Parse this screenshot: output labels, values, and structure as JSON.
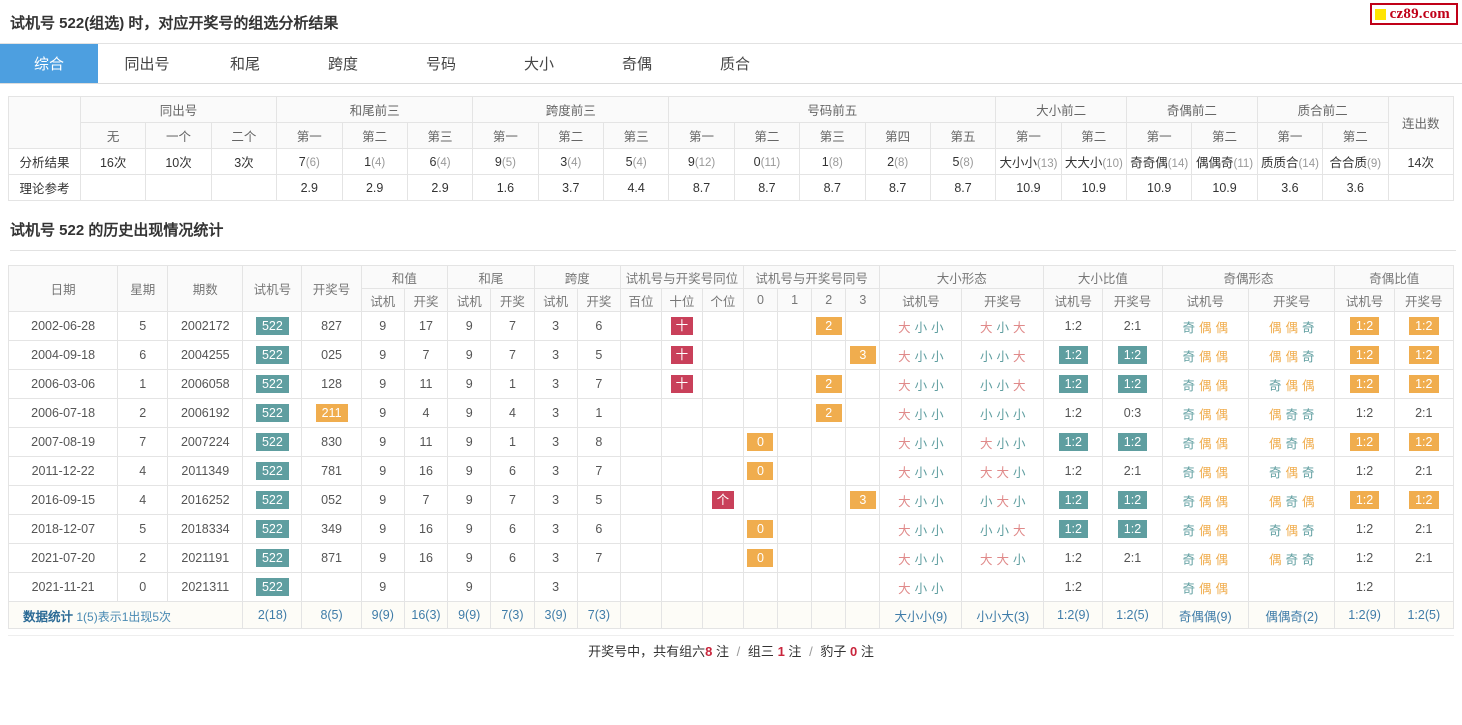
{
  "logo": {
    "text": "cz89.com",
    "square_color": "#ffe400",
    "border_color": "#c00018"
  },
  "header": {
    "title": "试机号 522(组选) 时，对应开奖号的组选分析结果"
  },
  "tabs": [
    {
      "label": "综合",
      "active": true
    },
    {
      "label": "同出号",
      "active": false
    },
    {
      "label": "和尾",
      "active": false
    },
    {
      "label": "跨度",
      "active": false
    },
    {
      "label": "号码",
      "active": false
    },
    {
      "label": "大小",
      "active": false
    },
    {
      "label": "奇偶",
      "active": false
    },
    {
      "label": "质合",
      "active": false
    }
  ],
  "summary": {
    "groups": [
      {
        "label": "",
        "span": 1
      },
      {
        "label": "同出号",
        "span": 3
      },
      {
        "label": "和尾前三",
        "span": 3
      },
      {
        "label": "跨度前三",
        "span": 3
      },
      {
        "label": "号码前五",
        "span": 5
      },
      {
        "label": "大小前二",
        "span": 2
      },
      {
        "label": "奇偶前二",
        "span": 2
      },
      {
        "label": "质合前二",
        "span": 2
      },
      {
        "label": "连出数",
        "span": 1,
        "rowspan": 2
      }
    ],
    "subheaders": [
      "",
      "无",
      "一个",
      "二个",
      "第一",
      "第二",
      "第三",
      "第一",
      "第二",
      "第三",
      "第一",
      "第二",
      "第三",
      "第四",
      "第五",
      "第一",
      "第二",
      "第一",
      "第二",
      "第一",
      "第二"
    ],
    "rows": [
      {
        "label": "分析结果",
        "cells": [
          {
            "main": "16次",
            "sub": ""
          },
          {
            "main": "10次",
            "sub": ""
          },
          {
            "main": "3次",
            "sub": ""
          },
          {
            "main": "7",
            "sub": "(6)"
          },
          {
            "main": "1",
            "sub": "(4)"
          },
          {
            "main": "6",
            "sub": "(4)"
          },
          {
            "main": "9",
            "sub": "(5)"
          },
          {
            "main": "3",
            "sub": "(4)"
          },
          {
            "main": "5",
            "sub": "(4)"
          },
          {
            "main": "9",
            "sub": "(12)"
          },
          {
            "main": "0",
            "sub": "(11)"
          },
          {
            "main": "1",
            "sub": "(8)"
          },
          {
            "main": "2",
            "sub": "(8)"
          },
          {
            "main": "5",
            "sub": "(8)"
          },
          {
            "main": "大小小",
            "sub": "(13)"
          },
          {
            "main": "大大小",
            "sub": "(10)"
          },
          {
            "main": "奇奇偶",
            "sub": "(14)"
          },
          {
            "main": "偶偶奇",
            "sub": "(11)"
          },
          {
            "main": "质质合",
            "sub": "(14)"
          },
          {
            "main": "合合质",
            "sub": "(9)"
          },
          {
            "main": "14次",
            "sub": ""
          }
        ]
      },
      {
        "label": "理论参考",
        "cells": [
          {
            "main": "",
            "sub": ""
          },
          {
            "main": "",
            "sub": ""
          },
          {
            "main": "",
            "sub": ""
          },
          {
            "main": "2.9",
            "sub": ""
          },
          {
            "main": "2.9",
            "sub": ""
          },
          {
            "main": "2.9",
            "sub": ""
          },
          {
            "main": "1.6",
            "sub": ""
          },
          {
            "main": "3.7",
            "sub": ""
          },
          {
            "main": "4.4",
            "sub": ""
          },
          {
            "main": "8.7",
            "sub": ""
          },
          {
            "main": "8.7",
            "sub": ""
          },
          {
            "main": "8.7",
            "sub": ""
          },
          {
            "main": "8.7",
            "sub": ""
          },
          {
            "main": "8.7",
            "sub": ""
          },
          {
            "main": "10.9",
            "sub": ""
          },
          {
            "main": "10.9",
            "sub": ""
          },
          {
            "main": "10.9",
            "sub": ""
          },
          {
            "main": "10.9",
            "sub": ""
          },
          {
            "main": "3.6",
            "sub": ""
          },
          {
            "main": "3.6",
            "sub": ""
          },
          {
            "main": "",
            "sub": ""
          }
        ]
      }
    ]
  },
  "section": {
    "title": "试机号 522 的历史出现情况统计"
  },
  "history": {
    "group_headers": [
      {
        "label": "日期",
        "span": 1,
        "rowspan": 2
      },
      {
        "label": "星期",
        "span": 1,
        "rowspan": 2
      },
      {
        "label": "期数",
        "span": 1,
        "rowspan": 2
      },
      {
        "label": "试机号",
        "span": 1,
        "rowspan": 2
      },
      {
        "label": "开奖号",
        "span": 1,
        "rowspan": 2
      },
      {
        "label": "和值",
        "span": 2
      },
      {
        "label": "和尾",
        "span": 2
      },
      {
        "label": "跨度",
        "span": 2
      },
      {
        "label": "试机号与开奖号同位",
        "span": 3
      },
      {
        "label": "试机号与开奖号同号",
        "span": 4
      },
      {
        "label": "大小形态",
        "span": 2
      },
      {
        "label": "大小比值",
        "span": 2
      },
      {
        "label": "奇偶形态",
        "span": 2
      },
      {
        "label": "奇偶比值",
        "span": 2
      }
    ],
    "sub_headers": [
      "试机",
      "开奖",
      "试机",
      "开奖",
      "试机",
      "开奖",
      "百位",
      "十位",
      "个位",
      "0",
      "1",
      "2",
      "3",
      "试机号",
      "开奖号",
      "试机号",
      "开奖号",
      "试机号",
      "开奖号",
      "试机号",
      "开奖号"
    ],
    "rows": [
      {
        "date": "2002-06-28",
        "week": "5",
        "issue": "2002172",
        "test": "522",
        "draw": "827",
        "draw_badge": false,
        "he_test": "9",
        "he_draw": "17",
        "wei_test": "9",
        "wei_draw": "7",
        "kua_test": "3",
        "kua_draw": "6",
        "pos": [
          "",
          "十",
          ""
        ],
        "pos_badge": [
          false,
          true,
          false
        ],
        "same": [
          "",
          "",
          "2",
          ""
        ],
        "same_badge": [
          false,
          false,
          true,
          false
        ],
        "size_test": "大小小",
        "size_draw": "大小大",
        "size_ratio_test": "1:2",
        "size_ratio_test_badge": false,
        "size_ratio_draw": "2:1",
        "size_ratio_draw_badge": false,
        "size_ratio_draw_color": "rose",
        "par_test": "奇偶偶",
        "par_draw": "偶偶奇",
        "par_ratio_test": "1:2",
        "par_ratio_test_badge": true,
        "par_ratio_draw": "1:2",
        "par_ratio_draw_badge": true
      },
      {
        "date": "2004-09-18",
        "week": "6",
        "issue": "2004255",
        "test": "522",
        "draw": "025",
        "draw_badge": false,
        "he_test": "9",
        "he_draw": "7",
        "wei_test": "9",
        "wei_draw": "7",
        "kua_test": "3",
        "kua_draw": "5",
        "pos": [
          "",
          "十",
          ""
        ],
        "pos_badge": [
          false,
          true,
          false
        ],
        "same": [
          "",
          "",
          "",
          "3"
        ],
        "same_badge": [
          false,
          false,
          false,
          true
        ],
        "size_test": "大小小",
        "size_draw": "小小大",
        "size_ratio_test": "1:2",
        "size_ratio_test_badge": true,
        "size_ratio_draw": "1:2",
        "size_ratio_draw_badge": true,
        "size_ratio_draw_color": "",
        "par_test": "奇偶偶",
        "par_draw": "偶偶奇",
        "par_ratio_test": "1:2",
        "par_ratio_test_badge": true,
        "par_ratio_draw": "1:2",
        "par_ratio_draw_badge": true
      },
      {
        "date": "2006-03-06",
        "week": "1",
        "issue": "2006058",
        "test": "522",
        "draw": "128",
        "draw_badge": false,
        "he_test": "9",
        "he_draw": "11",
        "wei_test": "9",
        "wei_draw": "1",
        "kua_test": "3",
        "kua_draw": "7",
        "pos": [
          "",
          "十",
          ""
        ],
        "pos_badge": [
          false,
          true,
          false
        ],
        "same": [
          "",
          "",
          "2",
          ""
        ],
        "same_badge": [
          false,
          false,
          true,
          false
        ],
        "size_test": "大小小",
        "size_draw": "小小大",
        "size_ratio_test": "1:2",
        "size_ratio_test_badge": true,
        "size_ratio_draw": "1:2",
        "size_ratio_draw_badge": true,
        "size_ratio_draw_color": "",
        "par_test": "奇偶偶",
        "par_draw": "奇偶偶",
        "par_ratio_test": "1:2",
        "par_ratio_test_badge": true,
        "par_ratio_draw": "1:2",
        "par_ratio_draw_badge": true
      },
      {
        "date": "2006-07-18",
        "week": "2",
        "issue": "2006192",
        "test": "522",
        "draw": "211",
        "draw_badge": true,
        "he_test": "9",
        "he_draw": "4",
        "wei_test": "9",
        "wei_draw": "4",
        "kua_test": "3",
        "kua_draw": "1",
        "pos": [
          "",
          "",
          ""
        ],
        "pos_badge": [
          false,
          false,
          false
        ],
        "same": [
          "",
          "",
          "2",
          ""
        ],
        "same_badge": [
          false,
          false,
          true,
          false
        ],
        "size_test": "大小小",
        "size_draw": "小小小",
        "size_ratio_test": "1:2",
        "size_ratio_test_badge": false,
        "size_ratio_draw": "0:3",
        "size_ratio_draw_badge": false,
        "size_ratio_draw_color": "rose",
        "par_test": "奇偶偶",
        "par_draw": "偶奇奇",
        "par_ratio_test": "1:2",
        "par_ratio_test_badge": false,
        "par_ratio_draw": "2:1",
        "par_ratio_draw_badge": false
      },
      {
        "date": "2007-08-19",
        "week": "7",
        "issue": "2007224",
        "test": "522",
        "draw": "830",
        "draw_badge": false,
        "he_test": "9",
        "he_draw": "11",
        "wei_test": "9",
        "wei_draw": "1",
        "kua_test": "3",
        "kua_draw": "8",
        "pos": [
          "",
          "",
          ""
        ],
        "pos_badge": [
          false,
          false,
          false
        ],
        "same": [
          "0",
          "",
          "",
          ""
        ],
        "same_badge": [
          true,
          false,
          false,
          false
        ],
        "size_test": "大小小",
        "size_draw": "大小小",
        "size_ratio_test": "1:2",
        "size_ratio_test_badge": true,
        "size_ratio_draw": "1:2",
        "size_ratio_draw_badge": true,
        "size_ratio_draw_color": "",
        "par_test": "奇偶偶",
        "par_draw": "偶奇偶",
        "par_ratio_test": "1:2",
        "par_ratio_test_badge": true,
        "par_ratio_draw": "1:2",
        "par_ratio_draw_badge": true
      },
      {
        "date": "2011-12-22",
        "week": "4",
        "issue": "2011349",
        "test": "522",
        "draw": "781",
        "draw_badge": false,
        "he_test": "9",
        "he_draw": "16",
        "wei_test": "9",
        "wei_draw": "6",
        "kua_test": "3",
        "kua_draw": "7",
        "pos": [
          "",
          "",
          ""
        ],
        "pos_badge": [
          false,
          false,
          false
        ],
        "same": [
          "0",
          "",
          "",
          ""
        ],
        "same_badge": [
          true,
          false,
          false,
          false
        ],
        "size_test": "大小小",
        "size_draw": "大大小",
        "size_ratio_test": "1:2",
        "size_ratio_test_badge": false,
        "size_ratio_draw": "2:1",
        "size_ratio_draw_badge": false,
        "size_ratio_draw_color": "rose",
        "par_test": "奇偶偶",
        "par_draw": "奇偶奇",
        "par_ratio_test": "1:2",
        "par_ratio_test_badge": false,
        "par_ratio_draw": "2:1",
        "par_ratio_draw_badge": false
      },
      {
        "date": "2016-09-15",
        "week": "4",
        "issue": "2016252",
        "test": "522",
        "draw": "052",
        "draw_badge": false,
        "he_test": "9",
        "he_draw": "7",
        "wei_test": "9",
        "wei_draw": "7",
        "kua_test": "3",
        "kua_draw": "5",
        "pos": [
          "",
          "",
          "个"
        ],
        "pos_badge": [
          false,
          false,
          true
        ],
        "same": [
          "",
          "",
          "",
          "3"
        ],
        "same_badge": [
          false,
          false,
          false,
          true
        ],
        "size_test": "大小小",
        "size_draw": "小大小",
        "size_ratio_test": "1:2",
        "size_ratio_test_badge": true,
        "size_ratio_draw": "1:2",
        "size_ratio_draw_badge": true,
        "size_ratio_draw_color": "",
        "par_test": "奇偶偶",
        "par_draw": "偶奇偶",
        "par_ratio_test": "1:2",
        "par_ratio_test_badge": true,
        "par_ratio_draw": "1:2",
        "par_ratio_draw_badge": true
      },
      {
        "date": "2018-12-07",
        "week": "5",
        "issue": "2018334",
        "test": "522",
        "draw": "349",
        "draw_badge": false,
        "he_test": "9",
        "he_draw": "16",
        "wei_test": "9",
        "wei_draw": "6",
        "kua_test": "3",
        "kua_draw": "6",
        "pos": [
          "",
          "",
          ""
        ],
        "pos_badge": [
          false,
          false,
          false
        ],
        "same": [
          "0",
          "",
          "",
          ""
        ],
        "same_badge": [
          true,
          false,
          false,
          false
        ],
        "size_test": "大小小",
        "size_draw": "小小大",
        "size_ratio_test": "1:2",
        "size_ratio_test_badge": true,
        "size_ratio_draw": "1:2",
        "size_ratio_draw_badge": true,
        "size_ratio_draw_color": "",
        "par_test": "奇偶偶",
        "par_draw": "奇偶奇",
        "par_ratio_test": "1:2",
        "par_ratio_test_badge": false,
        "par_ratio_draw": "2:1",
        "par_ratio_draw_badge": false
      },
      {
        "date": "2021-07-20",
        "week": "2",
        "issue": "2021191",
        "test": "522",
        "draw": "871",
        "draw_badge": false,
        "he_test": "9",
        "he_draw": "16",
        "wei_test": "9",
        "wei_draw": "6",
        "kua_test": "3",
        "kua_draw": "7",
        "pos": [
          "",
          "",
          ""
        ],
        "pos_badge": [
          false,
          false,
          false
        ],
        "same": [
          "0",
          "",
          "",
          ""
        ],
        "same_badge": [
          true,
          false,
          false,
          false
        ],
        "size_test": "大小小",
        "size_draw": "大大小",
        "size_ratio_test": "1:2",
        "size_ratio_test_badge": false,
        "size_ratio_draw": "2:1",
        "size_ratio_draw_badge": false,
        "size_ratio_draw_color": "rose",
        "par_test": "奇偶偶",
        "par_draw": "偶奇奇",
        "par_ratio_test": "1:2",
        "par_ratio_test_badge": false,
        "par_ratio_draw": "2:1",
        "par_ratio_draw_badge": false
      },
      {
        "date": "2021-11-21",
        "week": "0",
        "issue": "2021311",
        "test": "522",
        "draw": "",
        "draw_badge": false,
        "he_test": "9",
        "he_draw": "",
        "wei_test": "9",
        "wei_draw": "",
        "kua_test": "3",
        "kua_draw": "",
        "pos": [
          "",
          "",
          ""
        ],
        "pos_badge": [
          false,
          false,
          false
        ],
        "same": [
          "",
          "",
          "",
          ""
        ],
        "same_badge": [
          false,
          false,
          false,
          false
        ],
        "size_test": "大小小",
        "size_draw": "",
        "size_ratio_test": "1:2",
        "size_ratio_test_badge": false,
        "size_ratio_draw": "",
        "size_ratio_draw_badge": false,
        "size_ratio_draw_color": "",
        "par_test": "奇偶偶",
        "par_draw": "",
        "par_ratio_test": "1:2",
        "par_ratio_test_badge": false,
        "par_ratio_draw": "",
        "par_ratio_draw_badge": false
      }
    ],
    "stats": {
      "label": "数据统计",
      "note": "1(5)表示1出现5次",
      "test_num": "2(18)",
      "draw_num": "8(5)",
      "he_test": "9(9)",
      "he_draw": "16(3)",
      "wei_test": "9(9)",
      "wei_draw": "7(3)",
      "kua_test": "3(9)",
      "kua_draw": "7(3)",
      "pos": [
        "",
        "",
        ""
      ],
      "same": [
        "",
        "",
        "",
        ""
      ],
      "size_test": "大小小(9)",
      "size_draw": "小小大(3)",
      "size_ratio_test": "1:2(9)",
      "size_ratio_draw": "1:2(5)",
      "par_test": "奇偶偶(9)",
      "par_draw": "偶偶奇(2)",
      "par_ratio_test": "1:2(9)",
      "par_ratio_draw": "1:2(5)"
    }
  },
  "footer": {
    "prefix": "开奖号中，共有组六",
    "zuliu_count": "8",
    "mid1": "注",
    "sep1": "/",
    "zusan_label": "组三",
    "zusan_count": "1",
    "mid2": "注",
    "sep2": "/",
    "baozi_label": "豹子",
    "baozi_count": "0",
    "suffix": "注"
  },
  "colors": {
    "accent_blue": "#4d9fe0",
    "teal": "#5f9ea0",
    "orange": "#f0ad4e",
    "red": "#c9405a",
    "stat_blue": "#3f7ca8"
  }
}
